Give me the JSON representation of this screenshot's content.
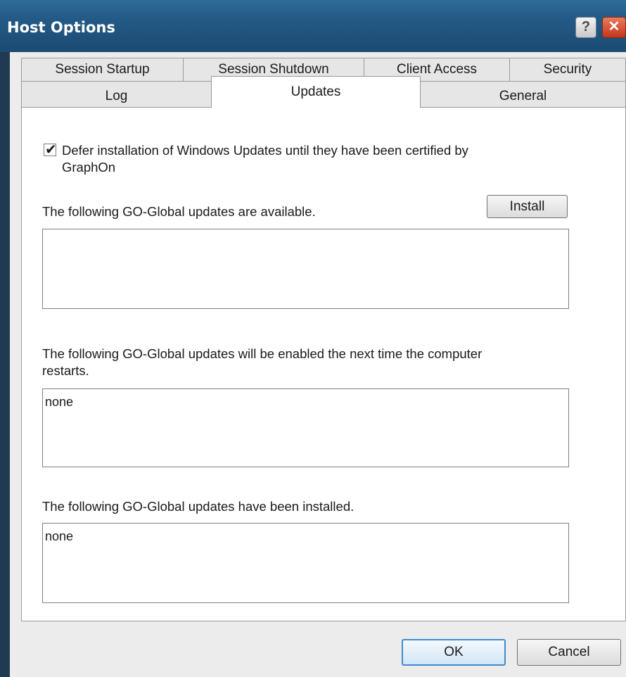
{
  "window": {
    "title": "Host Options",
    "help_glyph": "?",
    "close_glyph": "✕"
  },
  "tabs_row1": [
    {
      "label": "Session Startup"
    },
    {
      "label": "Session Shutdown"
    },
    {
      "label": "Client Access"
    },
    {
      "label": "Security"
    }
  ],
  "tabs_row2": [
    {
      "label": "Log"
    },
    {
      "label": "Updates",
      "selected": true
    },
    {
      "label": "General"
    }
  ],
  "updates": {
    "defer_checkbox": {
      "checked": true,
      "check_glyph": "✔",
      "label_line1": "Defer installation of Windows Updates until they have been certified by",
      "label_line2": "GraphOn"
    },
    "available_label": "The following GO-Global updates are available.",
    "install_button": "Install",
    "available_list": "",
    "restart_label_line1": "The following GO-Global updates will be enabled the next time the computer",
    "restart_label_line2": "restarts.",
    "restart_list": "none",
    "installed_label": "The following GO-Global updates have been installed.",
    "installed_list": "none"
  },
  "footer": {
    "ok": "OK",
    "cancel": "Cancel"
  }
}
